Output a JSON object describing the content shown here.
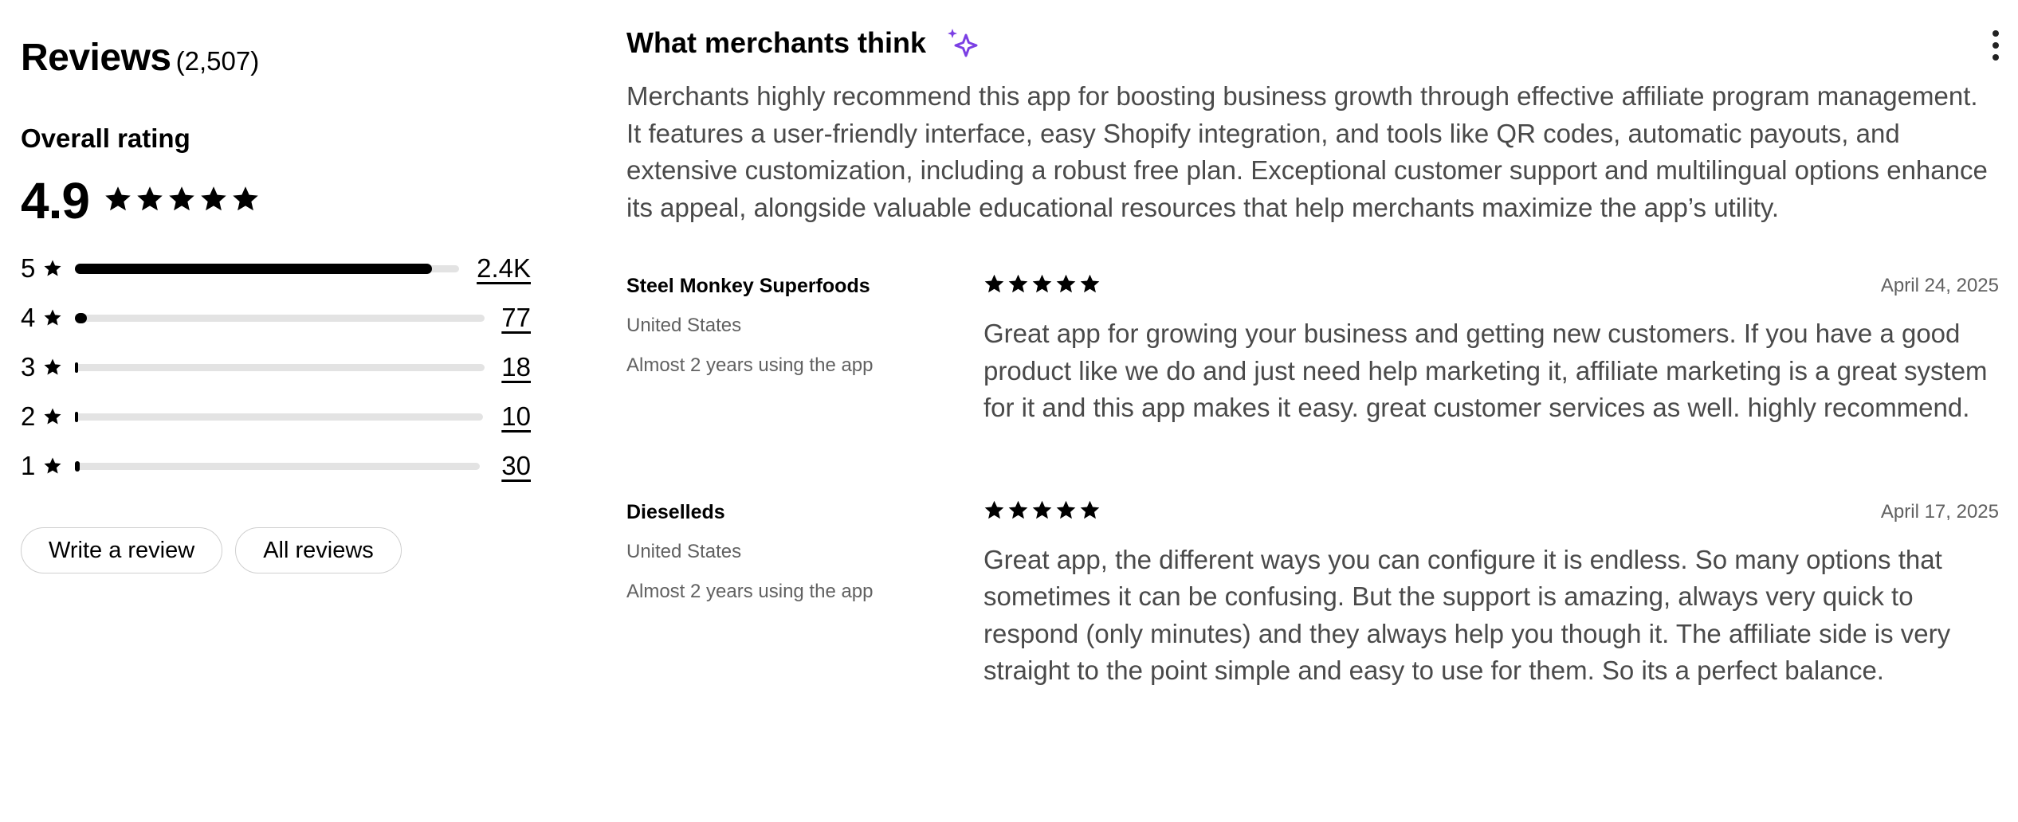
{
  "reviews": {
    "title": "Reviews",
    "count": "(2,507)",
    "overall_label": "Overall rating",
    "rating": "4.9",
    "rating_stars": 5,
    "distribution": [
      {
        "stars": "5",
        "count": "2.4K",
        "fraction": 0.93
      },
      {
        "stars": "4",
        "count": "77",
        "fraction": 0.03
      },
      {
        "stars": "3",
        "count": "18",
        "fraction": 0.007
      },
      {
        "stars": "2",
        "count": "10",
        "fraction": 0.004
      },
      {
        "stars": "1",
        "count": "30",
        "fraction": 0.012
      }
    ],
    "write_review_label": "Write a review",
    "all_reviews_label": "All reviews"
  },
  "summary": {
    "title": "What merchants think",
    "icon": "sparkle-icon",
    "accent_color": "#7b3fe4",
    "text": "Merchants highly recommend this app for boosting business growth through effective affiliate program management. It features a user-friendly interface, easy Shopify integration, and tools like QR codes, automatic payouts, and extensive customization, including a robust free plan. Exceptional customer support and multilingual options enhance its appeal, alongside valuable educational resources that help merchants maximize the app’s utility."
  },
  "review_list": [
    {
      "name": "Steel Monkey Superfoods",
      "country": "United States",
      "usage": "Almost 2 years using the app",
      "stars": 5,
      "date": "April 24, 2025",
      "text": "Great app for growing your business and getting new customers. If you have a good product like we do and just need help marketing it, affiliate marketing is a great system for it and this app makes it easy. great customer services as well. highly recommend."
    },
    {
      "name": "Dieselleds",
      "country": "United States",
      "usage": "Almost 2 years using the app",
      "stars": 5,
      "date": "April 17, 2025",
      "text": "Great app, the different ways you can configure it is endless. So many options that sometimes it can be confusing. But the support is amazing, always very quick to respond (only minutes) and they always help you though it. The affiliate side is very straight to the point simple and easy to use for them. So its a perfect balance."
    }
  ]
}
